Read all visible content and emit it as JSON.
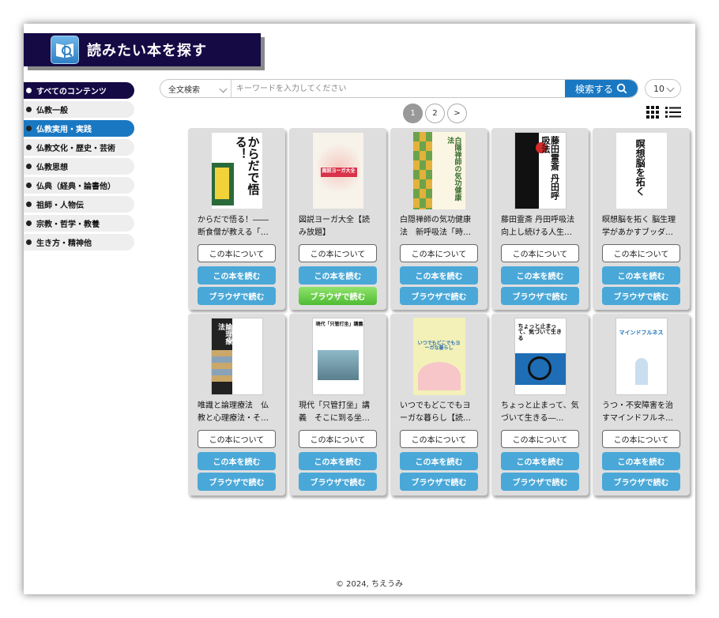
{
  "header": {
    "title": "読みたい本を探す",
    "icon": "book-search-icon"
  },
  "sidebar": {
    "items": [
      {
        "label": "すべてのコンテンツ",
        "style": "dark"
      },
      {
        "label": "仏教一般",
        "style": ""
      },
      {
        "label": "仏教実用・実践",
        "style": "blue"
      },
      {
        "label": "仏教文化・歴史・芸術",
        "style": ""
      },
      {
        "label": "仏教思想",
        "style": ""
      },
      {
        "label": "仏典（経典・論書他）",
        "style": ""
      },
      {
        "label": "祖師・人物伝",
        "style": ""
      },
      {
        "label": "宗教・哲学・教養",
        "style": ""
      },
      {
        "label": "生き方・精神他",
        "style": ""
      }
    ]
  },
  "search": {
    "mode": "全文検索",
    "placeholder": "キーワードを入力してください",
    "value": "",
    "button_label": "検索する",
    "per_page": "10"
  },
  "pagination": {
    "pages": [
      "1",
      "2"
    ],
    "current": "1",
    "next": ">"
  },
  "buttons": {
    "about": "この本について",
    "read": "この本を読む",
    "browser": "ブラウザで読む"
  },
  "books": [
    {
      "title": "からだで悟る！――断食僧が教える「…",
      "cover_text": "からだで悟る！"
    },
    {
      "title": "図説ヨーガ大全【読み放題】",
      "cover_text": "図説ヨーガ大全"
    },
    {
      "title": "白隠禅師の気功健康法　新呼吸法「時…",
      "cover_text": "白隠禅師の気功健康法"
    },
    {
      "title": "藤田霊斎 丹田呼吸法 向上し続ける人生…",
      "cover_text": "藤田霊斎 丹田呼吸法"
    },
    {
      "title": "瞑想脳を拓く 脳生理学があかすブッダ…",
      "cover_text": "瞑想脳を拓く"
    },
    {
      "title": "唯識と論理療法　仏教と心理療法・そ…",
      "cover_text": "唯識と論理療法"
    },
    {
      "title": "現代「只管打坐」講義　そこに到る坐…",
      "cover_text": "現代「只管打坐」講義"
    },
    {
      "title": "いつでもどこでもヨーガな暮らし【読…",
      "cover_text": "いつでもどこでもヨーガな暮らし"
    },
    {
      "title": "ちょっと止まって、気づいて生きる―…",
      "cover_text": "ちょっと止まって、気づいて生きる"
    },
    {
      "title": "うつ・不安障害を治すマインドフルネ…",
      "cover_text": "マインドフルネス"
    }
  ],
  "footer": "© 2024, ちえうみ",
  "colors": {
    "navy": "#160a45",
    "blue": "#1a78c2",
    "button_blue": "#4aa8d8",
    "green": "#5fc43e"
  }
}
